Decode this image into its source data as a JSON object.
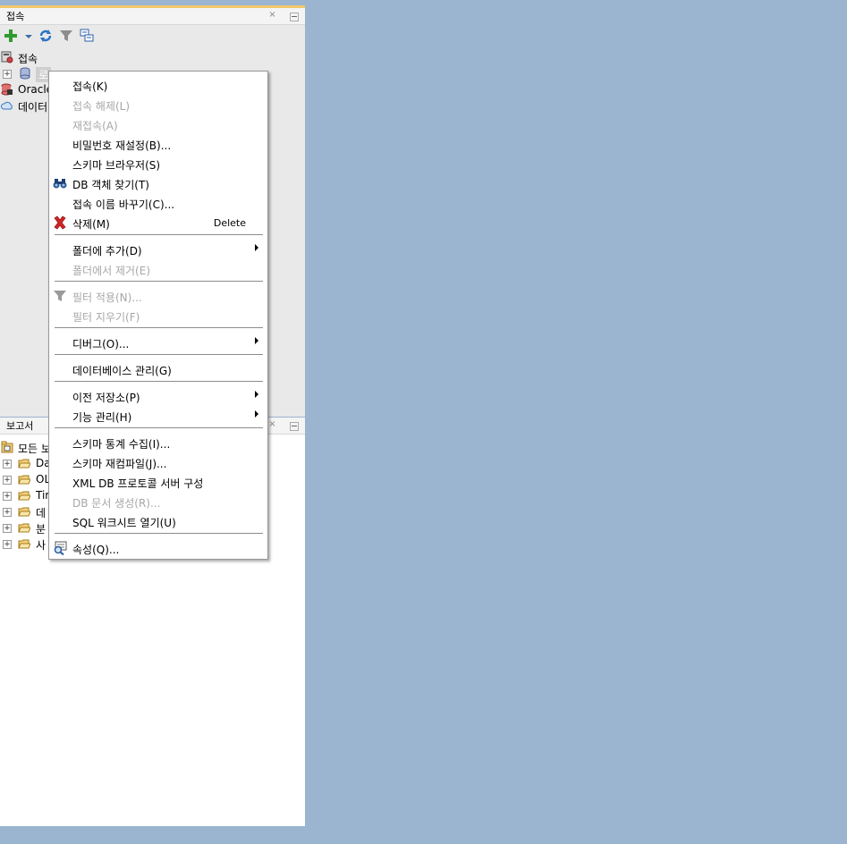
{
  "colors": {
    "background": "#9bb4cf",
    "panel": "#e9e9e9",
    "accent": "#f2c86b"
  },
  "connections_panel": {
    "title": "접속",
    "toolbar": [
      "add-icon",
      "dropdown-arrow-icon",
      "refresh-icon",
      "filter-icon",
      "schema-icon"
    ],
    "tree": {
      "root_label": "접속",
      "items": [
        {
          "label": "로",
          "icon": "database-icon"
        },
        {
          "label": "Oracle",
          "icon": "oracle-db-icon"
        },
        {
          "label": "데이터",
          "icon": "cloud-icon"
        }
      ]
    }
  },
  "reports_panel": {
    "title": "보고서",
    "tree": {
      "root_label": "모든 보",
      "items": [
        {
          "label": "Da"
        },
        {
          "label": "OL"
        },
        {
          "label": "Tir"
        },
        {
          "label": "데"
        },
        {
          "label": "분"
        },
        {
          "label": "사"
        }
      ]
    }
  },
  "context_menu": {
    "items": [
      {
        "label": "접속(K)",
        "enabled": true
      },
      {
        "label": "접속 해제(L)",
        "enabled": false
      },
      {
        "label": "재접속(A)",
        "enabled": false
      },
      {
        "label": "비밀번호 재설정(B)...",
        "enabled": true
      },
      {
        "label": "스키마 브라우저(S)",
        "enabled": true
      },
      {
        "label": "DB 객체 찾기(T)",
        "enabled": true,
        "icon": "binoculars-icon"
      },
      {
        "label": "접속 이름 바꾸기(C)...",
        "enabled": true
      },
      {
        "label": "삭제(M)",
        "enabled": true,
        "icon": "delete-x-icon",
        "shortcut": "Delete"
      },
      {
        "label": "폴더에 추가(D)",
        "enabled": true,
        "submenu": true
      },
      {
        "label": "폴더에서 제거(E)",
        "enabled": false
      },
      {
        "label": "필터 적용(N)...",
        "enabled": false,
        "icon": "filter-icon"
      },
      {
        "label": "필터 지우기(F)",
        "enabled": false
      },
      {
        "label": "디버그(O)...",
        "enabled": true,
        "submenu": true
      },
      {
        "label": "데이터베이스 관리(G)",
        "enabled": true
      },
      {
        "label": "이전 저장소(P)",
        "enabled": true,
        "submenu": true
      },
      {
        "label": "기능 관리(H)",
        "enabled": true,
        "submenu": true
      },
      {
        "label": "스키마 통계 수집(I)...",
        "enabled": true
      },
      {
        "label": "스키마 재컴파일(J)...",
        "enabled": true
      },
      {
        "label": "XML DB 프로토콜 서버 구성",
        "enabled": true
      },
      {
        "label": "DB 문서 생성(R)...",
        "enabled": false
      },
      {
        "label": "SQL 워크시트 열기(U)",
        "enabled": true
      },
      {
        "label": "속성(Q)...",
        "enabled": true,
        "icon": "properties-icon"
      }
    ]
  }
}
